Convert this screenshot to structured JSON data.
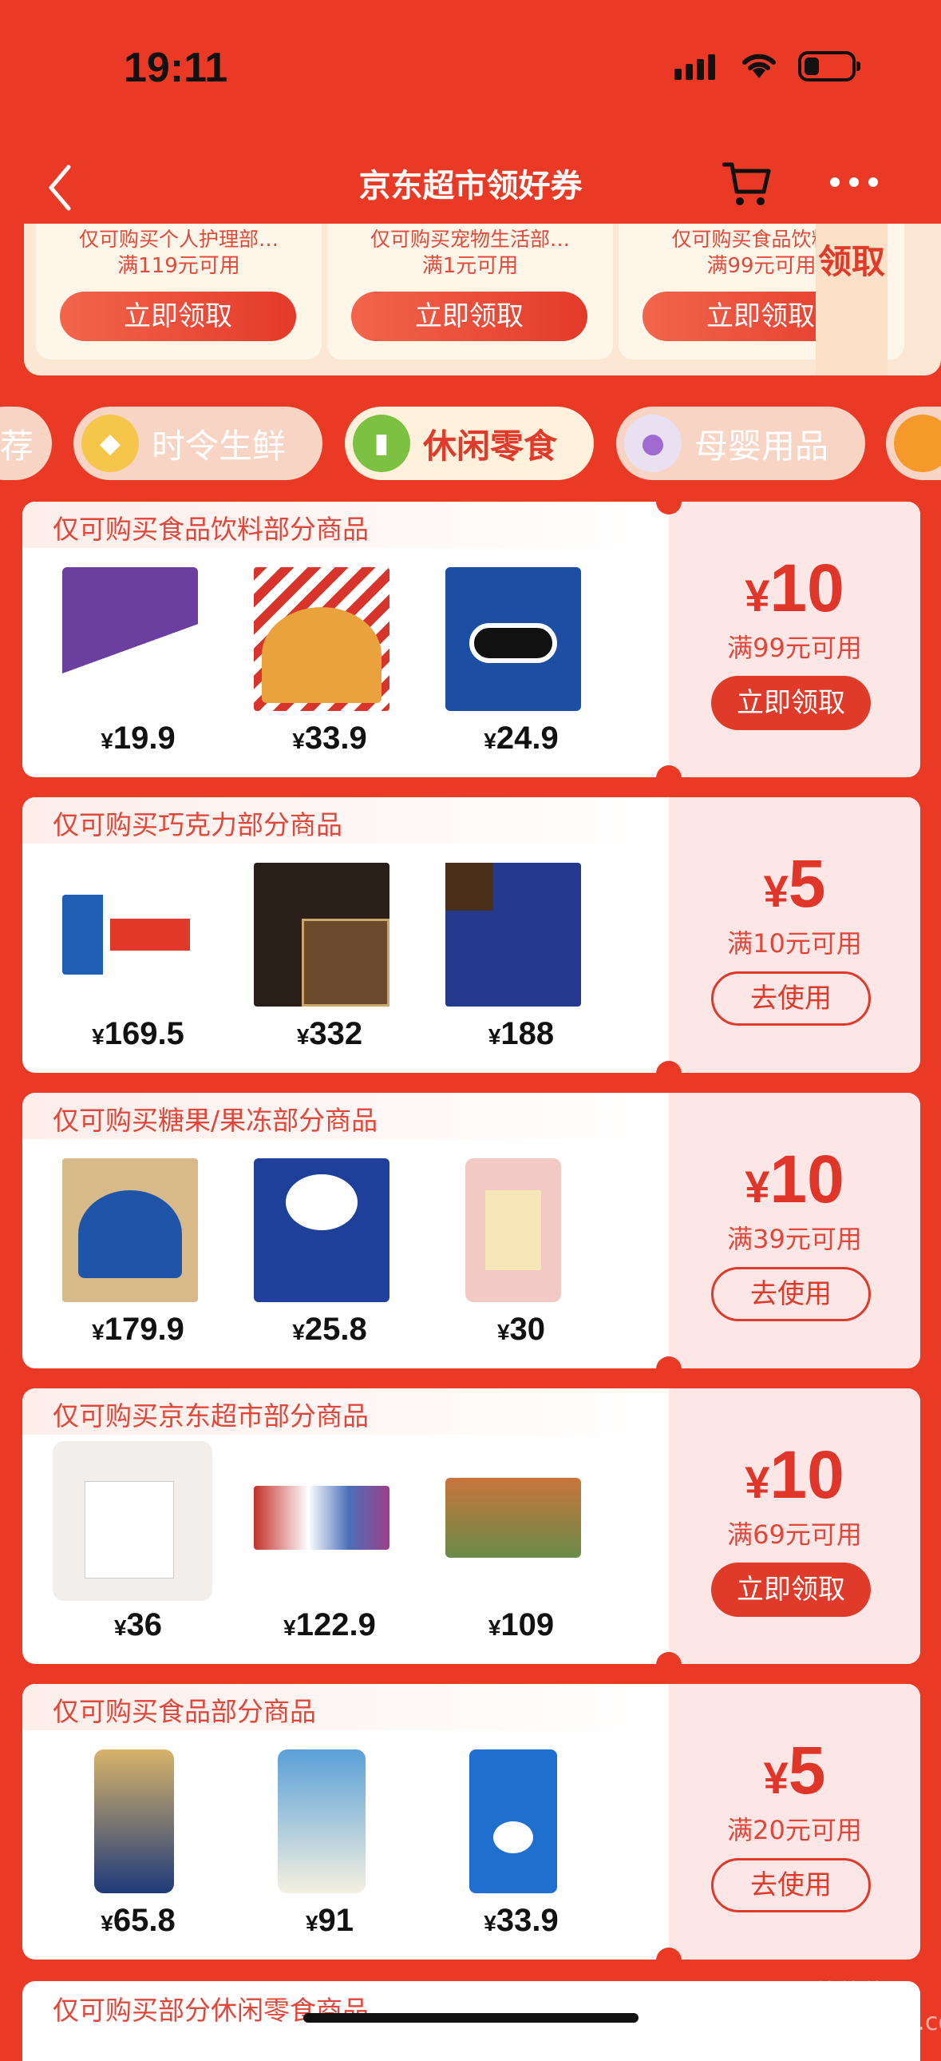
{
  "status": {
    "time": "19:11"
  },
  "nav": {
    "title": "京东超市领好券"
  },
  "top_coupons": [
    {
      "desc": "仅可购买个人护理部…",
      "cond": "满119元可用",
      "button": "立即领取"
    },
    {
      "desc": "仅可购买宠物生活部…",
      "cond": "满1元可用",
      "button": "立即领取"
    },
    {
      "desc": "仅可购买食品饮料…",
      "cond": "满99元可用",
      "button": "立即领取"
    }
  ],
  "claim_tab": "领取",
  "categories": [
    "荐",
    "时令生鲜",
    "休闲零食",
    "母婴用品"
  ],
  "coupons": [
    {
      "header": "仅可购买食品饮料部分商品",
      "prices": [
        "19.9",
        "33.9",
        "24.9"
      ],
      "amount": "10",
      "cond": "满99元可用",
      "action": "立即领取"
    },
    {
      "header": "仅可购买巧克力部分商品",
      "prices": [
        "169.5",
        "332",
        "188"
      ],
      "amount": "5",
      "cond": "满10元可用",
      "action": "去使用"
    },
    {
      "header": "仅可购买糖果/果冻部分商品",
      "prices": [
        "179.9",
        "25.8",
        "30"
      ],
      "amount": "10",
      "cond": "满39元可用",
      "action": "去使用"
    },
    {
      "header": "仅可购买京东超市部分商品",
      "prices": [
        "36",
        "122.9",
        "109"
      ],
      "amount": "10",
      "cond": "满69元可用",
      "action": "立即领取"
    },
    {
      "header": "仅可购买食品部分商品",
      "prices": [
        "65.8",
        "91",
        "33.9"
      ],
      "amount": "5",
      "cond": "满20元可用",
      "action": "去使用"
    }
  ],
  "last_header": "仅可购买部分休闲零食商品",
  "currency": "¥",
  "watermark": "值值值 zhizhizhi.com"
}
